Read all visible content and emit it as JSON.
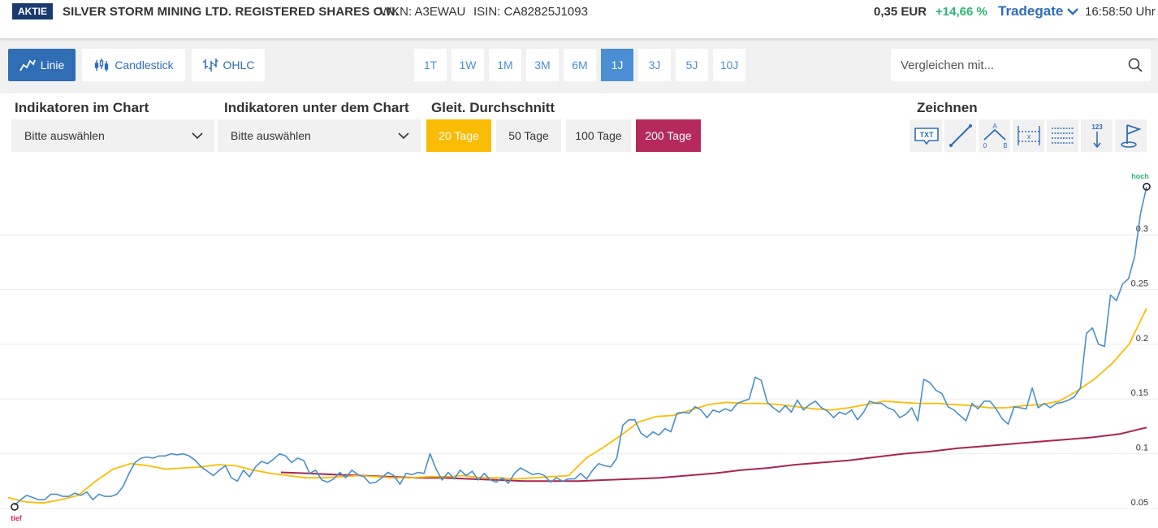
{
  "header": {
    "badge": "AKTIE",
    "name": "SILVER STORM MINING LTD. REGISTERED SHARES O.N.",
    "wkn": "WKN: A3EWAU",
    "isin": "ISIN: CA82825J1093",
    "price": "0,35 EUR",
    "change": "+14,66 %",
    "exchange": "Tradegate",
    "time": "16:58:50 Uhr"
  },
  "toolbar": {
    "chart_types": [
      "Linie",
      "Candlestick",
      "OHLC"
    ],
    "active_type": "Linie",
    "ranges": [
      "1T",
      "1W",
      "1M",
      "3M",
      "6M",
      "1J",
      "3J",
      "5J",
      "10J"
    ],
    "active_range": "1J",
    "compare_placeholder": "Vergleichen mit..."
  },
  "indicators": {
    "in_chart_label": "Indikatoren im Chart",
    "in_chart_value": "Bitte auswählen",
    "below_chart_label": "Indikatoren unter dem Chart",
    "below_chart_value": "Bitte auswählen",
    "ma_label": "Gleit. Durchschnitt",
    "ma_options": [
      "20 Tage",
      "50 Tage",
      "100 Tage",
      "200 Tage"
    ],
    "draw_label": "Zeichnen",
    "draw_tools": [
      "text-tool-icon",
      "line-tool-icon",
      "abc-tool-icon",
      "measure-tool-icon",
      "fibonacci-tool-icon",
      "counter-tool-icon",
      "flag-tool-icon"
    ]
  },
  "colors": {
    "accent": "#2f6db5",
    "price_line": "#4a8fc8",
    "ma20": "#fbbc05",
    "ma200": "#a8264f",
    "positive": "#2bb673",
    "low": "#d6246e"
  },
  "chart_data": {
    "type": "line",
    "y_ticks": [
      0.05,
      0.1,
      0.15,
      0.2,
      0.25,
      0.3
    ],
    "y_tick_labels": [
      "0.05",
      "0.1",
      "0.15",
      "0.2",
      "0.25",
      "0.3"
    ],
    "ylim": [
      0.047,
      0.355
    ],
    "high_label": "hoch",
    "low_label": "tief",
    "series": [
      {
        "key": "price",
        "values": [
          0.053,
          0.058,
          0.062,
          0.06,
          0.058,
          0.058,
          0.063,
          0.063,
          0.061,
          0.061,
          0.064,
          0.062,
          0.065,
          0.058,
          0.063,
          0.061,
          0.061,
          0.063,
          0.07,
          0.082,
          0.092,
          0.096,
          0.097,
          0.096,
          0.098,
          0.098,
          0.1,
          0.099,
          0.1,
          0.098,
          0.094,
          0.088,
          0.084,
          0.08,
          0.085,
          0.089,
          0.078,
          0.075,
          0.085,
          0.079,
          0.088,
          0.093,
          0.091,
          0.095,
          0.1,
          0.098,
          0.092,
          0.096,
          0.094,
          0.082,
          0.085,
          0.076,
          0.074,
          0.077,
          0.083,
          0.078,
          0.085,
          0.081,
          0.079,
          0.073,
          0.074,
          0.078,
          0.083,
          0.08,
          0.072,
          0.082,
          0.081,
          0.083,
          0.082,
          0.1,
          0.086,
          0.076,
          0.083,
          0.077,
          0.085,
          0.08,
          0.084,
          0.076,
          0.082,
          0.076,
          0.074,
          0.078,
          0.073,
          0.082,
          0.087,
          0.084,
          0.081,
          0.082,
          0.08,
          0.074,
          0.078,
          0.075,
          0.077,
          0.077,
          0.082,
          0.077,
          0.085,
          0.091,
          0.089,
          0.088,
          0.096,
          0.126,
          0.131,
          0.131,
          0.119,
          0.115,
          0.12,
          0.117,
          0.123,
          0.12,
          0.137,
          0.138,
          0.137,
          0.143,
          0.14,
          0.133,
          0.14,
          0.138,
          0.141,
          0.139,
          0.146,
          0.148,
          0.15,
          0.17,
          0.167,
          0.147,
          0.142,
          0.138,
          0.144,
          0.138,
          0.149,
          0.14,
          0.145,
          0.148,
          0.142,
          0.139,
          0.133,
          0.138,
          0.136,
          0.14,
          0.131,
          0.138,
          0.148,
          0.146,
          0.146,
          0.142,
          0.14,
          0.133,
          0.136,
          0.142,
          0.13,
          0.168,
          0.165,
          0.158,
          0.155,
          0.143,
          0.14,
          0.135,
          0.13,
          0.146,
          0.141,
          0.148,
          0.148,
          0.141,
          0.132,
          0.127,
          0.143,
          0.142,
          0.141,
          0.16,
          0.142,
          0.146,
          0.142,
          0.146,
          0.147,
          0.149,
          0.152,
          0.16,
          0.21,
          0.215,
          0.2,
          0.198,
          0.245,
          0.24,
          0.255,
          0.26,
          0.28,
          0.32,
          0.344
        ]
      },
      {
        "key": "ma20",
        "values": [
          0.06,
          0.056,
          0.055,
          0.058,
          0.062,
          0.075,
          0.086,
          0.091,
          0.089,
          0.086,
          0.087,
          0.088,
          0.09,
          0.089,
          0.085,
          0.082,
          0.08,
          0.078,
          0.078,
          0.079,
          0.08,
          0.079,
          0.078,
          0.078,
          0.079,
          0.079,
          0.08,
          0.078,
          0.078,
          0.077,
          0.078,
          0.079,
          0.08,
          0.096,
          0.106,
          0.117,
          0.129,
          0.134,
          0.135,
          0.14,
          0.145,
          0.147,
          0.146,
          0.146,
          0.145,
          0.143,
          0.141,
          0.14,
          0.142,
          0.145,
          0.148,
          0.147,
          0.146,
          0.146,
          0.145,
          0.144,
          0.142,
          0.142,
          0.144,
          0.145,
          0.148,
          0.157,
          0.168,
          0.182,
          0.2,
          0.233
        ]
      },
      {
        "key": "ma200",
        "values": [
          0.083,
          0.082,
          0.081,
          0.08,
          0.079,
          0.078,
          0.078,
          0.077,
          0.076,
          0.075,
          0.075,
          0.075,
          0.076,
          0.077,
          0.078,
          0.08,
          0.082,
          0.085,
          0.087,
          0.09,
          0.092,
          0.094,
          0.097,
          0.1,
          0.102,
          0.105,
          0.107,
          0.109,
          0.111,
          0.113,
          0.115,
          0.118,
          0.124
        ]
      }
    ]
  }
}
